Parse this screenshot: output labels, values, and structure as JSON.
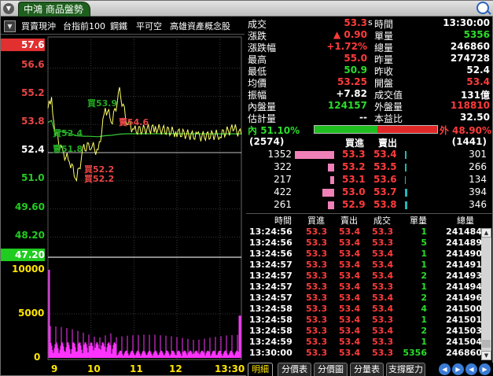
{
  "window": {
    "title": "中鴻 商品盤勢",
    "menu_glyph": "▼"
  },
  "toolbar": {
    "dropdown_glyph": "▼",
    "items": [
      "買賣現沖",
      "台指前100",
      "鋼鐵",
      "平可空",
      "高雄資產概念股"
    ]
  },
  "chart": {
    "price_labels": [
      "57.6",
      "56.6",
      "55.2",
      "53.8",
      "52.4",
      "51.0",
      "49.60",
      "48.20",
      "47.20"
    ],
    "volume_labels": [
      "10000",
      "5000",
      "0"
    ],
    "time_labels": [
      "9",
      "10",
      "11",
      "12",
      "13:30"
    ],
    "annotations": [
      "買53.9",
      "賣54.6",
      "買52.4",
      "賣51.8",
      "買52.2",
      "買52.2"
    ],
    "colors": {
      "price_line": "#ffff66",
      "avg_line": "#33cc33",
      "volume": "#ff33ff",
      "ref_line": "#ffffff"
    }
  },
  "chart_data": {
    "type": "line",
    "title": "",
    "x_range": [
      "9:00",
      "13:30"
    ],
    "ylim": [
      47.2,
      57.6
    ],
    "price_series_approx": [
      {
        "time": "9:00",
        "price": 54.6
      },
      {
        "time": "9:05",
        "price": 55.0
      },
      {
        "time": "9:10",
        "price": 53.5
      },
      {
        "time": "9:20",
        "price": 52.4
      },
      {
        "time": "9:30",
        "price": 52.0
      },
      {
        "time": "9:40",
        "price": 51.1
      },
      {
        "time": "9:50",
        "price": 52.6
      },
      {
        "time": "10:00",
        "price": 52.8
      },
      {
        "time": "10:10",
        "price": 52.4
      },
      {
        "time": "10:20",
        "price": 54.6
      },
      {
        "time": "10:30",
        "price": 54.0
      },
      {
        "time": "10:40",
        "price": 55.4
      },
      {
        "time": "10:50",
        "price": 54.0
      },
      {
        "time": "11:00",
        "price": 53.5
      },
      {
        "time": "11:30",
        "price": 53.6
      },
      {
        "time": "12:00",
        "price": 53.4
      },
      {
        "time": "12:30",
        "price": 53.2
      },
      {
        "time": "13:00",
        "price": 53.3
      },
      {
        "time": "13:20",
        "price": 53.6
      },
      {
        "time": "13:30",
        "price": 53.3
      }
    ],
    "volume_axis": [
      0,
      10000
    ]
  },
  "quote": {
    "left": [
      {
        "k": "成交",
        "v": "53.3",
        "u": "s",
        "c": "red"
      },
      {
        "k": "漲跌",
        "v": "▲ 0.90",
        "c": "red"
      },
      {
        "k": "漲跌幅",
        "v": "+1.72%",
        "c": "red"
      },
      {
        "k": "最高",
        "v": "55.0",
        "c": "red"
      },
      {
        "k": "最低",
        "v": "50.9",
        "c": "grn"
      },
      {
        "k": "均價",
        "v": "53.25",
        "c": "red"
      },
      {
        "k": "振幅",
        "v": "+7.82",
        "c": "wht"
      },
      {
        "k": "內盤量",
        "v": "124157",
        "c": "grn"
      },
      {
        "k": "估計量",
        "v": "--",
        "c": "wht"
      }
    ],
    "right": [
      {
        "k": "時間",
        "v": "13:30:00",
        "c": "wht"
      },
      {
        "k": "單量",
        "v": "5356",
        "c": "grn"
      },
      {
        "k": "總量",
        "v": "246860",
        "c": "wht"
      },
      {
        "k": "昨量",
        "v": "274728",
        "c": "wht"
      },
      {
        "k": "昨收",
        "v": "52.4",
        "c": "wht"
      },
      {
        "k": "開盤",
        "v": "53.4",
        "c": "red"
      },
      {
        "k": "成交值",
        "v": "131億",
        "c": "wht"
      },
      {
        "k": "外盤量",
        "v": "118810",
        "c": "red"
      },
      {
        "k": "本益比",
        "v": "32.50",
        "c": "wht"
      }
    ]
  },
  "ratio": {
    "inner_label": "內",
    "inner_pct": "51.10%",
    "outer_label": "外",
    "outer_pct": "48.90%",
    "inner_fraction": 0.511
  },
  "book": {
    "bid_total": "(2574)",
    "ask_total": "(1441)",
    "bid_header": "買進",
    "ask_header": "賣出",
    "rows": [
      {
        "bq": "1352",
        "bp": "53.3",
        "ap": "53.4",
        "aq": "301",
        "bw": 1.0,
        "aw": 0.2
      },
      {
        "bq": "322",
        "bp": "53.2",
        "ap": "53.5",
        "aq": "266",
        "bw": 0.15,
        "aw": 0.18
      },
      {
        "bq": "217",
        "bp": "53.1",
        "ap": "53.6",
        "aq": "134",
        "bw": 0.1,
        "aw": 0.1
      },
      {
        "bq": "422",
        "bp": "53.0",
        "ap": "53.7",
        "aq": "394",
        "bw": 0.3,
        "aw": 0.25
      },
      {
        "bq": "261",
        "bp": "52.9",
        "ap": "53.8",
        "aq": "346",
        "bw": 0.15,
        "aw": 0.22
      }
    ]
  },
  "ticks": {
    "headers": [
      "時間",
      "買進",
      "賣出",
      "成交",
      "單量",
      "總量"
    ],
    "rows": [
      [
        "13:24:56",
        "53.3",
        "53.4",
        "53.3",
        "1",
        "241484"
      ],
      [
        "13:24:56",
        "53.3",
        "53.4",
        "53.3",
        "5",
        "241489"
      ],
      [
        "13:24:56",
        "53.3",
        "53.4",
        "53.4",
        "1",
        "241490"
      ],
      [
        "13:24:57",
        "53.3",
        "53.4",
        "53.4",
        "1",
        "241491"
      ],
      [
        "13:24:57",
        "53.3",
        "53.4",
        "53.4",
        "2",
        "241493"
      ],
      [
        "13:24:57",
        "53.3",
        "53.4",
        "53.3",
        "1",
        "241494"
      ],
      [
        "13:24:57",
        "53.3",
        "53.4",
        "53.4",
        "2",
        "241496"
      ],
      [
        "13:24:58",
        "53.3",
        "53.4",
        "53.4",
        "4",
        "241500"
      ],
      [
        "13:24:58",
        "53.3",
        "53.4",
        "53.3",
        "1",
        "241501"
      ],
      [
        "13:24:58",
        "53.3",
        "53.4",
        "53.4",
        "2",
        "241503"
      ],
      [
        "13:24:59",
        "53.3",
        "53.4",
        "53.3",
        "1",
        "241504"
      ],
      [
        "13:30:00",
        "53.3",
        "53.4",
        "53.3",
        "5356",
        "246860"
      ]
    ]
  },
  "tabs": [
    "明細",
    "分價表",
    "分價圖",
    "分量表",
    "支撐壓力"
  ],
  "nav": [
    "◀",
    "▶",
    "◀",
    "▶"
  ]
}
